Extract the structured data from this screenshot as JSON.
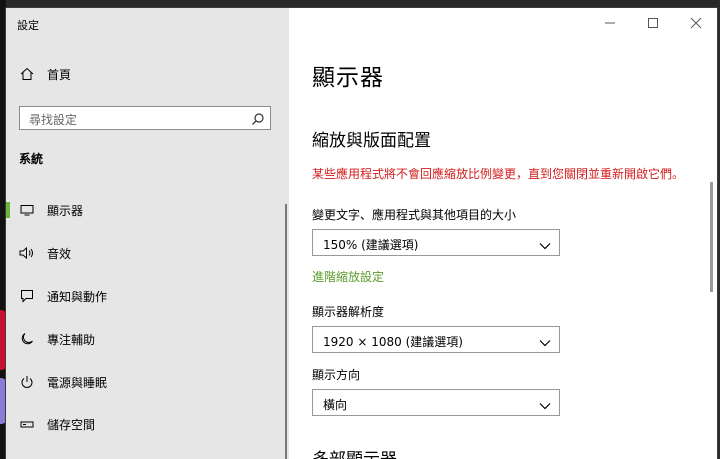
{
  "window": {
    "title": "設定"
  },
  "sidebar": {
    "home_label": "首頁",
    "search_placeholder": "尋找設定",
    "section": "系統",
    "items": [
      {
        "label": "顯示器",
        "icon": "monitor-icon",
        "active": true
      },
      {
        "label": "音效",
        "icon": "speaker-icon",
        "active": false
      },
      {
        "label": "通知與動作",
        "icon": "notification-icon",
        "active": false
      },
      {
        "label": "專注輔助",
        "icon": "moon-icon",
        "active": false
      },
      {
        "label": "電源與睡眠",
        "icon": "power-icon",
        "active": false
      },
      {
        "label": "儲存空間",
        "icon": "storage-icon",
        "active": false
      }
    ]
  },
  "content": {
    "page_title": "顯示器",
    "scale_heading": "縮放與版面配置",
    "warning": "某些應用程式將不會回應縮放比例變更，直到您關閉並重新開啟它們。",
    "scale_label": "變更文字、應用程式與其他項目的大小",
    "scale_value": "150% (建議選項)",
    "advanced_link": "進階縮放設定",
    "resolution_label": "顯示器解析度",
    "resolution_value": "1920 × 1080 (建議選項)",
    "orientation_label": "顯示方向",
    "orientation_value": "橫向",
    "next_heading": "多部顯示器"
  },
  "colors": {
    "accent": "#6db33f",
    "warning": "#d11d1d",
    "link": "#5b9b2c"
  }
}
